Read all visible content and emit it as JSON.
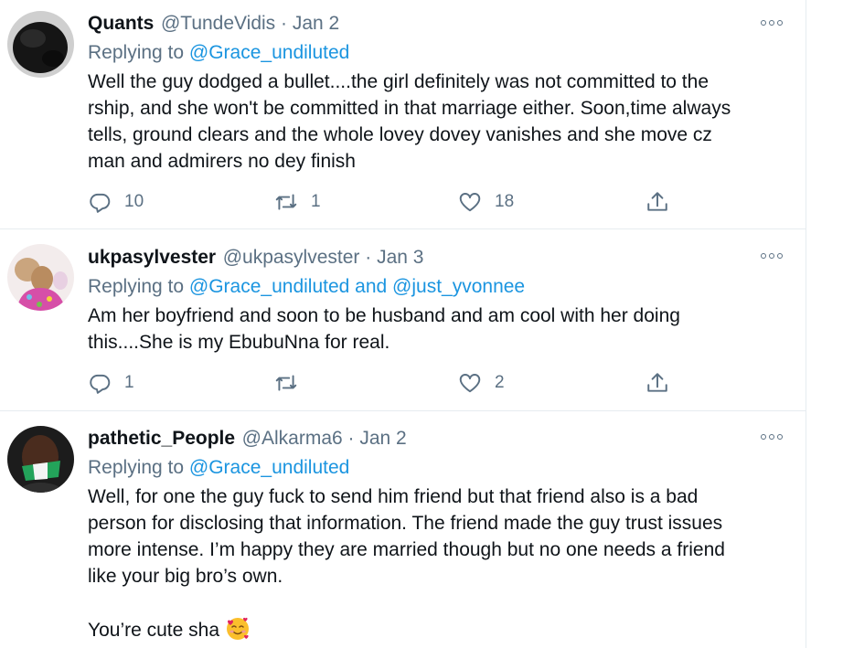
{
  "tweets": [
    {
      "name": "Quants",
      "handle": "@TundeVidis",
      "sep": " · ",
      "date": "Jan 2",
      "replying_prefix": "Replying to ",
      "replying_to": "@Grace_undiluted",
      "body_lines": [
        "Well the guy dodged a bullet....the girl definitely was not committed to the",
        "rship, and she won't be committed in that marriage either. Soon,time always",
        "tells, ground clears and the whole lovey dovey vanishes and she move cz",
        "man and admirers no dey finish"
      ],
      "replies": "10",
      "retweets": "1",
      "likes": "18"
    },
    {
      "name": "ukpasylvester",
      "handle": "@ukpasylvester",
      "sep": " · ",
      "date": "Jan 3",
      "replying_prefix": "Replying to ",
      "replying_to": "@Grace_undiluted and @just_yvonnee",
      "body_lines": [
        "Am her boyfriend and soon to be husband and am cool with her doing",
        "this....She is my EbubuNna for real."
      ],
      "replies": "1",
      "retweets": "",
      "likes": "2"
    },
    {
      "name": "pathetic_People",
      "handle": "@Alkarma6",
      "sep": " · ",
      "date": "Jan 2",
      "replying_prefix": "Replying to ",
      "replying_to": "@Grace_undiluted",
      "body_lines": [
        "Well, for one the guy fuck to send him friend but that friend also is a bad",
        "person for disclosing that information. The friend made the guy trust issues",
        "more intense. I’m happy they are married though but no one needs a friend",
        "like your big bro’s own."
      ],
      "body_extra": "You’re cute sha"
    }
  ],
  "icons": {
    "reply": "reply-icon",
    "retweet": "retweet-icon",
    "like": "heart-icon",
    "share": "share-icon",
    "more": "more-options-icon",
    "emoji": "smiling-face-with-hearts-emoji"
  },
  "colors": {
    "link": "#1b95e0",
    "secondary": "#5b7083",
    "text": "#0f1419",
    "divider": "#e6ecf0"
  }
}
